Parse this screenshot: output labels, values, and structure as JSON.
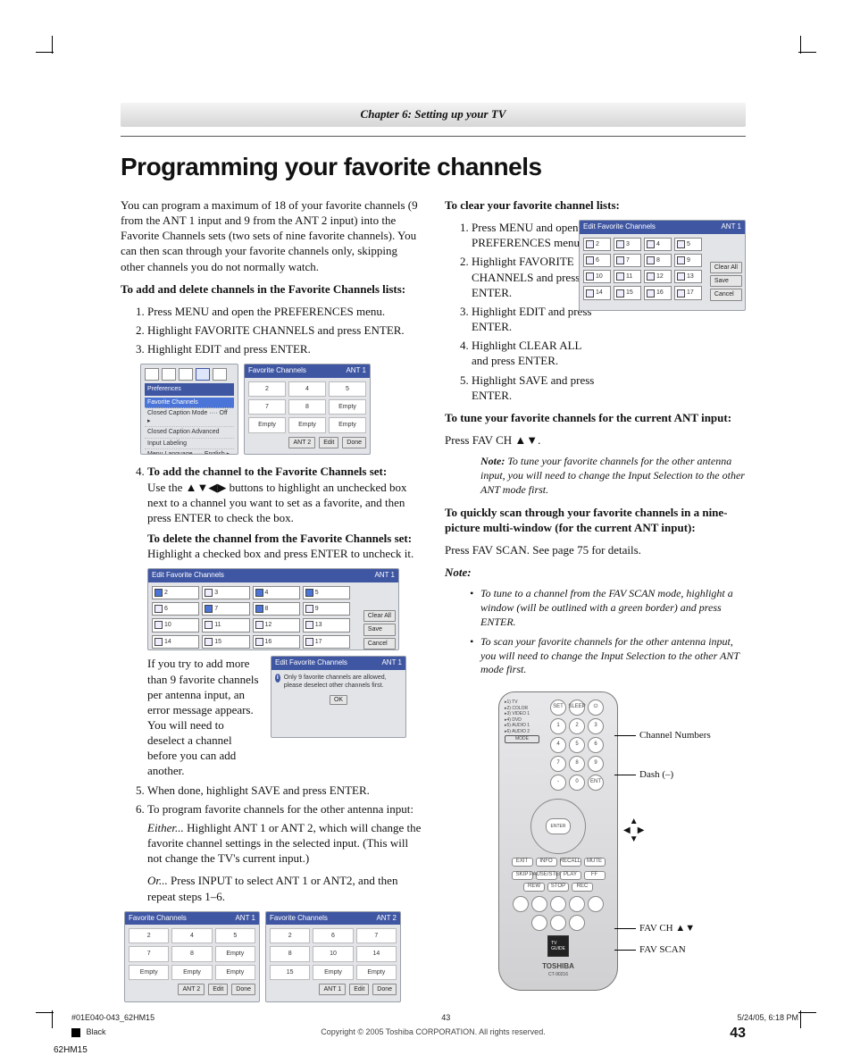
{
  "chapter_bar": "Chapter 6: Setting up your TV",
  "title": "Programming your favorite channels",
  "left": {
    "intro": "You can program a maximum of 18 of your favorite channels (9 from the ANT 1 input and 9 from the ANT 2 input) into the Favorite Channels sets (two sets of nine favorite channels). You can then scan through your favorite channels only, skipping other channels you do not normally watch.",
    "add_heading": "To add and delete channels in the Favorite Channels lists:",
    "steps_1_3": [
      "Press MENU and open the PREFERENCES menu.",
      "Highlight FAVORITE CHANNELS and press ENTER.",
      "Highlight EDIT and press ENTER."
    ],
    "pref_menu": {
      "title": "Preferences",
      "items": [
        "Favorite Channels",
        "Closed Caption Mode ···· Off ▸",
        "Closed Caption Advanced",
        "Input Labeling",
        "Menu Language ···· English ▸"
      ]
    },
    "fav_panel": {
      "title": "Favorite Channels",
      "ant": "ANT 1",
      "cells": [
        "2",
        "4",
        "5",
        "7",
        "8",
        "Empty",
        "Empty",
        "Empty",
        "Empty"
      ],
      "buttons": [
        "ANT 2",
        "Edit",
        "Done"
      ]
    },
    "step4_heading": "To add the channel to the Favorite Channels set:",
    "step4_body": "Use the ▲▼◀▶ buttons to highlight an unchecked box next to a channel you want to set as a favorite, and then press ENTER to check the box.",
    "delete_heading": "To delete the channel from the Favorite Channels set:",
    "delete_body": "Highlight a checked box and press ENTER to uncheck it.",
    "edit_panel": {
      "title": "Edit Favorite Channels",
      "ant": "ANT 1",
      "cells": [
        "2",
        "3",
        "4",
        "5",
        "6",
        "7",
        "8",
        "9",
        "10",
        "11",
        "12",
        "13",
        "14",
        "15",
        "16",
        "17"
      ],
      "side": [
        "Clear All",
        "Save",
        "Cancel"
      ]
    },
    "toomany_text": "If you try to add more than 9 favorite channels per antenna input, an error message appears. You will need to deselect a channel before you can add another.",
    "toomany_panel": {
      "title": "Edit Favorite Channels",
      "ant": "ANT 1",
      "msg": "Only 9 favorite channels are allowed, please deselect other channels first.",
      "ok": "OK"
    },
    "step5": "When done, highlight SAVE and press ENTER.",
    "step6": "To program favorite channels for the other antenna input:",
    "either_label": "Either...",
    "either_body": " Highlight ANT 1 or ANT 2, which will change the favorite channel settings in the selected input. (This will not change the TV's current input.)",
    "or_label": "Or...",
    "or_body": " Press INPUT to select ANT 1 or ANT2, and then repeat steps 1–6.",
    "panel_ant1": {
      "title": "Favorite Channels",
      "ant": "ANT 1",
      "cells": [
        "2",
        "4",
        "5",
        "7",
        "8",
        "Empty",
        "Empty",
        "Empty",
        "Empty"
      ],
      "buttons": [
        "ANT 2",
        "Edit",
        "Done"
      ]
    },
    "panel_ant2": {
      "title": "Favorite Channels",
      "ant": "ANT 2",
      "cells": [
        "2",
        "6",
        "7",
        "8",
        "10",
        "14",
        "15",
        "Empty",
        "Empty"
      ],
      "buttons": [
        "ANT 1",
        "Edit",
        "Done"
      ]
    }
  },
  "right": {
    "clear_heading": "To clear your favorite channel lists:",
    "clear_steps": [
      "Press MENU and open the PREFERENCES menu.",
      "Highlight FAVORITE CHANNELS and press ENTER.",
      "Highlight EDIT and press ENTER.",
      "Highlight CLEAR ALL and press ENTER.",
      "Highlight SAVE and press ENTER."
    ],
    "clear_panel": {
      "title": "Edit Favorite Channels",
      "ant": "ANT 1",
      "cells": [
        "2",
        "3",
        "4",
        "5",
        "6",
        "7",
        "8",
        "9",
        "10",
        "11",
        "12",
        "13",
        "14",
        "15",
        "16",
        "17"
      ],
      "side": [
        "Clear All",
        "Save",
        "Cancel"
      ]
    },
    "tune_heading": "To tune your favorite channels for the current ANT input:",
    "tune_body": "Press FAV CH ▲▼.",
    "tune_note": "To tune your favorite channels for the other antenna input, you will need to change the Input Selection to the other ANT mode first.",
    "scan_heading": "To quickly scan through your favorite channels in a nine-picture multi-window (for the current ANT input):",
    "scan_body": "Press FAV SCAN. See page 75 for details.",
    "note_label": "Note:",
    "notes": [
      "To tune to a channel from the FAV SCAN mode, highlight a window (will be outlined with a green border) and press ENTER.",
      "To scan your favorite channels for the other antenna input, you will need to change the Input Selection to the other ANT mode first."
    ],
    "remote": {
      "inputs": [
        "▸1) TV",
        "▸2) COLOR",
        "▸3) VIDEO 1",
        "▸4) DVD",
        "▸5) AUDIO 1",
        "▸6) AUDIO 2",
        "MODE"
      ],
      "toprow": [
        "SET",
        "SLEEP",
        "⏻"
      ],
      "numbers": [
        "1",
        "2",
        "3",
        "4",
        "5",
        "6",
        "7",
        "8",
        "9",
        "-",
        "0",
        "ENT"
      ],
      "enter": "ENTER",
      "midrow": [
        "EXIT",
        "INFO",
        "RECALL",
        "MUTE"
      ],
      "trans": [
        "SKIP",
        "PAUSE/STEP",
        "PLAY",
        "FF",
        "REW",
        "STOP",
        "REC"
      ],
      "favrow": [
        "FAV CH",
        "FAV SCAN"
      ],
      "brand": "TOSHIBA",
      "model": "CT-90216"
    },
    "callouts": {
      "numbers": "Channel Numbers",
      "dash": "Dash (–)",
      "arrows": "▲ ◀▶ ▼",
      "favch": "FAV CH ▲▼",
      "favscan": "FAV SCAN"
    }
  },
  "footer": {
    "copyright": "Copyright © 2005 Toshiba CORPORATION. All rights reserved.",
    "page_num": "43",
    "file": "#01E040-043_62HM15",
    "pg": "43",
    "date": "5/24/05, 6:18 PM",
    "color": "Black",
    "docid": "62HM15"
  }
}
